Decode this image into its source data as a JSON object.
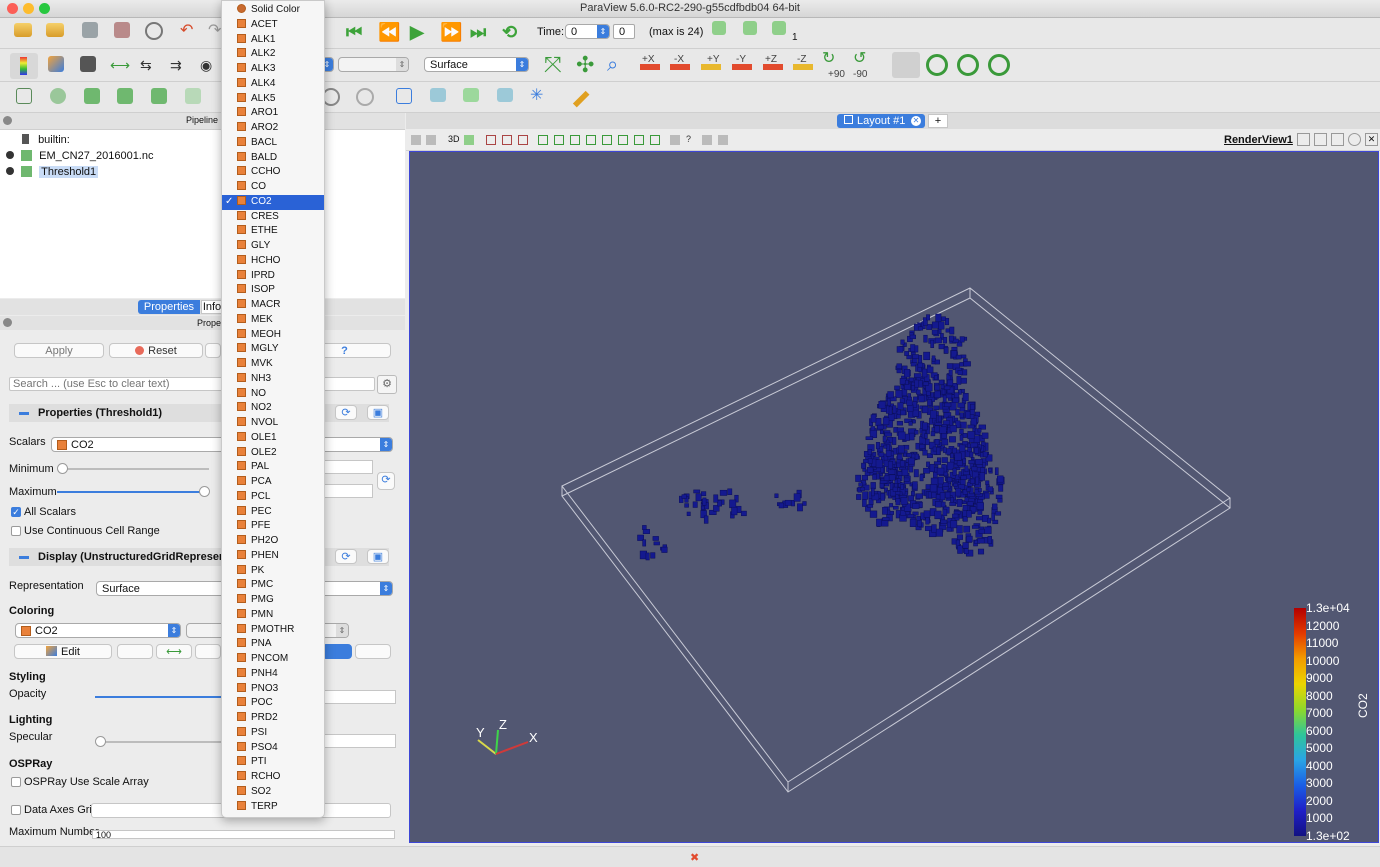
{
  "window": {
    "title": "ParaView 5.6.0-RC2-290-g55cdfbdb04 64-bit"
  },
  "toolbar": {
    "time_label": "Time:",
    "time_value": "0",
    "time_step": "0",
    "time_max": "(max is 24)",
    "time_tool_count": "1",
    "representation": "Surface",
    "camera_labels": [
      "+X",
      "-X",
      "+Y",
      "-Y",
      "+Z",
      "-Z"
    ],
    "rotate_labels": [
      "+90",
      "-90"
    ]
  },
  "pipeline": {
    "title": "Pipeline B",
    "items": [
      "builtin:",
      "EM_CN27_2016001.nc",
      "Threshold1"
    ]
  },
  "tabs": {
    "properties": "Properties",
    "information": "Info"
  },
  "properties": {
    "panel_title": "Proper",
    "apply": "Apply",
    "reset": "Reset",
    "help": "?",
    "search_placeholder": "Search ... (use Esc to clear text)",
    "section_properties": "Properties (Threshold1)",
    "scalars_label": "Scalars",
    "scalars_value": "CO2",
    "minimum_label": "Minimum",
    "minimum_fraction": 0.0,
    "maximum_label": "Maximum",
    "maximum_fraction": 1.0,
    "all_scalars_label": "All Scalars",
    "all_scalars_checked": true,
    "continuous_label": "Use Continuous Cell Range",
    "continuous_checked": false,
    "section_display": "Display (UnstructuredGridRepresentat",
    "representation_label": "Representation",
    "representation_value": "Surface",
    "coloring_label": "Coloring",
    "coloring_value": "CO2",
    "edit_label": "Edit",
    "styling_label": "Styling",
    "opacity_label": "Opacity",
    "opacity_fraction": 1.0,
    "lighting_label": "Lighting",
    "specular_label": "Specular",
    "specular_fraction": 0.0,
    "ospray_label": "OSPRay",
    "ospray_scale_label": "OSPRay Use Scale Array",
    "data_axes_grid_label": "Data Axes Grid",
    "max_number_label": "Maximum Number",
    "max_number_value": "100"
  },
  "color_menu": {
    "selected": "CO2",
    "items": [
      "Solid Color",
      "ACET",
      "ALK1",
      "ALK2",
      "ALK3",
      "ALK4",
      "ALK5",
      "ARO1",
      "ARO2",
      "BACL",
      "BALD",
      "CCHO",
      "CO",
      "CO2",
      "CRES",
      "ETHE",
      "GLY",
      "HCHO",
      "IPRD",
      "ISOP",
      "MACR",
      "MEK",
      "MEOH",
      "MGLY",
      "MVK",
      "NH3",
      "NO",
      "NO2",
      "NVOL",
      "OLE1",
      "OLE2",
      "PAL",
      "PCA",
      "PCL",
      "PEC",
      "PFE",
      "PH2O",
      "PHEN",
      "PK",
      "PMC",
      "PMG",
      "PMN",
      "PMOTHR",
      "PNA",
      "PNCOM",
      "PNH4",
      "PNO3",
      "POC",
      "PRD2",
      "PSI",
      "PSO4",
      "PTI",
      "RCHO",
      "SO2",
      "TERP"
    ]
  },
  "layout": {
    "tab_label": "Layout #1",
    "add_tab": "+",
    "view_label": "RenderView1",
    "view_toolbar_3d": "3D"
  },
  "render_view": {
    "background": "#525772",
    "orientation_axes": [
      "X",
      "Y",
      "Z"
    ],
    "legend_title": "CO2",
    "legend_labels": [
      "1.3e+04",
      "12000",
      "11000",
      "10000",
      "9000",
      "8000",
      "7000",
      "6000",
      "5000",
      "4000",
      "3000",
      "2000",
      "1000",
      "1.3e+02"
    ]
  },
  "colors": {
    "accent": "#3b7ddd",
    "selection": "#2a62d6",
    "particles": "#14198f"
  }
}
